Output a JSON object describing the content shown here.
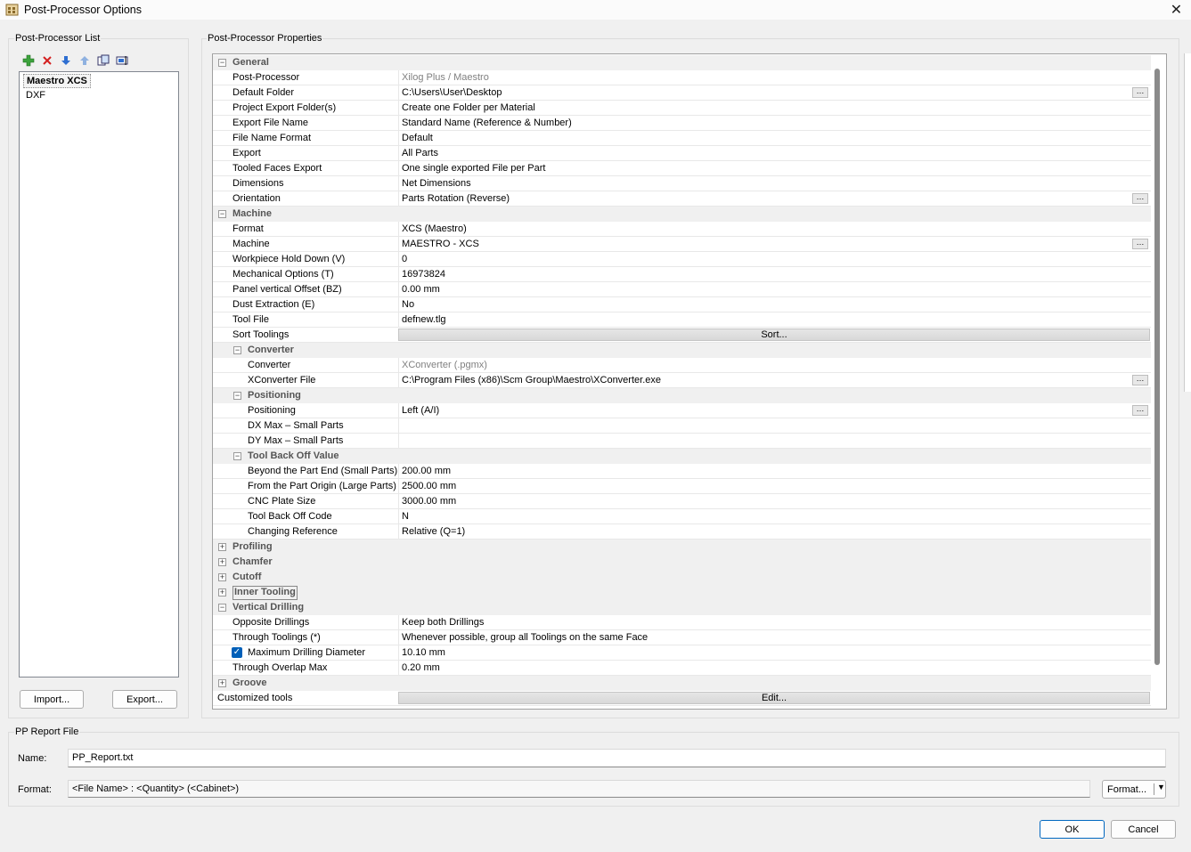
{
  "window": {
    "title": "Post-Processor Options"
  },
  "pp_list": {
    "group_label": "Post-Processor List",
    "items": [
      {
        "label": "Maestro XCS"
      },
      {
        "label": "DXF"
      }
    ],
    "import_label": "Import...",
    "export_label": "Export..."
  },
  "props": {
    "group_label": "Post-Processor Properties",
    "rows": [
      {
        "name": "General",
        "type": "cat",
        "level": 0,
        "expanded": true
      },
      {
        "name": "Post-Processor",
        "value": "Xilog Plus / Maestro",
        "gray": true,
        "level": 0
      },
      {
        "name": "Default Folder",
        "value": "C:\\Users\\User\\Desktop",
        "ellipsis": true,
        "level": 0
      },
      {
        "name": "Project Export Folder(s)",
        "value": "Create one Folder per Material",
        "level": 0
      },
      {
        "name": "Export File Name",
        "value": "Standard Name (Reference & Number)",
        "level": 0
      },
      {
        "name": "File Name Format",
        "value": "Default",
        "level": 0
      },
      {
        "name": "Export",
        "value": "All Parts",
        "level": 0
      },
      {
        "name": "Tooled Faces Export",
        "value": "One single exported File per Part",
        "level": 0
      },
      {
        "name": "Dimensions",
        "value": "Net Dimensions",
        "level": 0
      },
      {
        "name": "Orientation",
        "value": "Parts Rotation (Reverse)",
        "ellipsis": true,
        "level": 0
      },
      {
        "name": "Machine",
        "type": "cat",
        "level": 0,
        "expanded": true
      },
      {
        "name": "Format",
        "value": "XCS (Maestro)",
        "level": 0
      },
      {
        "name": "Machine",
        "value": "MAESTRO - XCS",
        "ellipsis": true,
        "level": 0
      },
      {
        "name": "Workpiece Hold Down (V)",
        "value": "0",
        "level": 0
      },
      {
        "name": "Mechanical Options (T)",
        "value": "16973824",
        "level": 0
      },
      {
        "name": "Panel vertical Offset (BZ)",
        "value": "0.00 mm",
        "level": 0
      },
      {
        "name": "Dust Extraction (E)",
        "value": "No",
        "level": 0
      },
      {
        "name": "Tool File",
        "value": "defnew.tlg",
        "level": 0
      },
      {
        "name": "Sort Toolings",
        "value": "Sort...",
        "action": true,
        "level": 0
      },
      {
        "name": "Converter",
        "type": "cat",
        "level": 1,
        "expanded": true
      },
      {
        "name": "Converter",
        "value": "XConverter (.pgmx)",
        "gray": true,
        "level": 1
      },
      {
        "name": "XConverter File",
        "value": "C:\\Program Files (x86)\\Scm Group\\Maestro\\XConverter.exe",
        "ellipsis": true,
        "level": 1
      },
      {
        "name": "Positioning",
        "type": "cat",
        "level": 1,
        "expanded": true
      },
      {
        "name": "Positioning",
        "value": "Left (A/I)",
        "ellipsis": true,
        "level": 1
      },
      {
        "name": "DX Max – Small Parts",
        "value": "",
        "level": 1
      },
      {
        "name": "DY Max – Small Parts",
        "value": "",
        "level": 1
      },
      {
        "name": "Tool Back Off Value",
        "type": "cat",
        "level": 1,
        "expanded": true
      },
      {
        "name": "Beyond the Part End (Small Parts)",
        "value": "200.00 mm",
        "level": 1
      },
      {
        "name": "From the Part Origin (Large Parts)",
        "value": "2500.00 mm",
        "level": 1
      },
      {
        "name": "CNC Plate Size",
        "value": "3000.00 mm",
        "level": 1
      },
      {
        "name": "Tool Back Off Code",
        "value": "N",
        "level": 1
      },
      {
        "name": "Changing Reference",
        "value": "Relative (Q=1)",
        "level": 1
      },
      {
        "name": "Profiling",
        "type": "cat",
        "level": 0,
        "expanded": false
      },
      {
        "name": "Chamfer",
        "type": "cat",
        "level": 0,
        "expanded": false
      },
      {
        "name": "Cutoff",
        "type": "cat",
        "level": 0,
        "expanded": false
      },
      {
        "name": "Inner Tooling",
        "type": "cat",
        "level": 0,
        "expanded": false,
        "focused": true
      },
      {
        "name": "Vertical Drilling",
        "type": "cat",
        "level": 0,
        "expanded": true
      },
      {
        "name": "Opposite Drillings",
        "value": "Keep both Drillings",
        "level": 0
      },
      {
        "name": "Through Toolings (*)",
        "value": "Whenever possible, group all Toolings on the same Face",
        "level": 0
      },
      {
        "name": "Maximum Drilling Diameter",
        "value": "10.10 mm",
        "level": 1,
        "checkbox": true
      },
      {
        "name": "Through Overlap Max",
        "value": "0.20 mm",
        "level": 0
      },
      {
        "name": "Groove",
        "type": "cat",
        "level": 0,
        "expanded": false
      },
      {
        "name": "Customized tools",
        "value": "Edit...",
        "action": true,
        "level": -1
      }
    ]
  },
  "report": {
    "group_label": "PP Report File",
    "name_label": "Name:",
    "name_value": "PP_Report.txt",
    "format_label": "Format:",
    "format_value": "<File Name> : <Quantity> (<Cabinet>)",
    "format_button": "Format..."
  },
  "dialog": {
    "ok_label": "OK",
    "cancel_label": "Cancel"
  }
}
